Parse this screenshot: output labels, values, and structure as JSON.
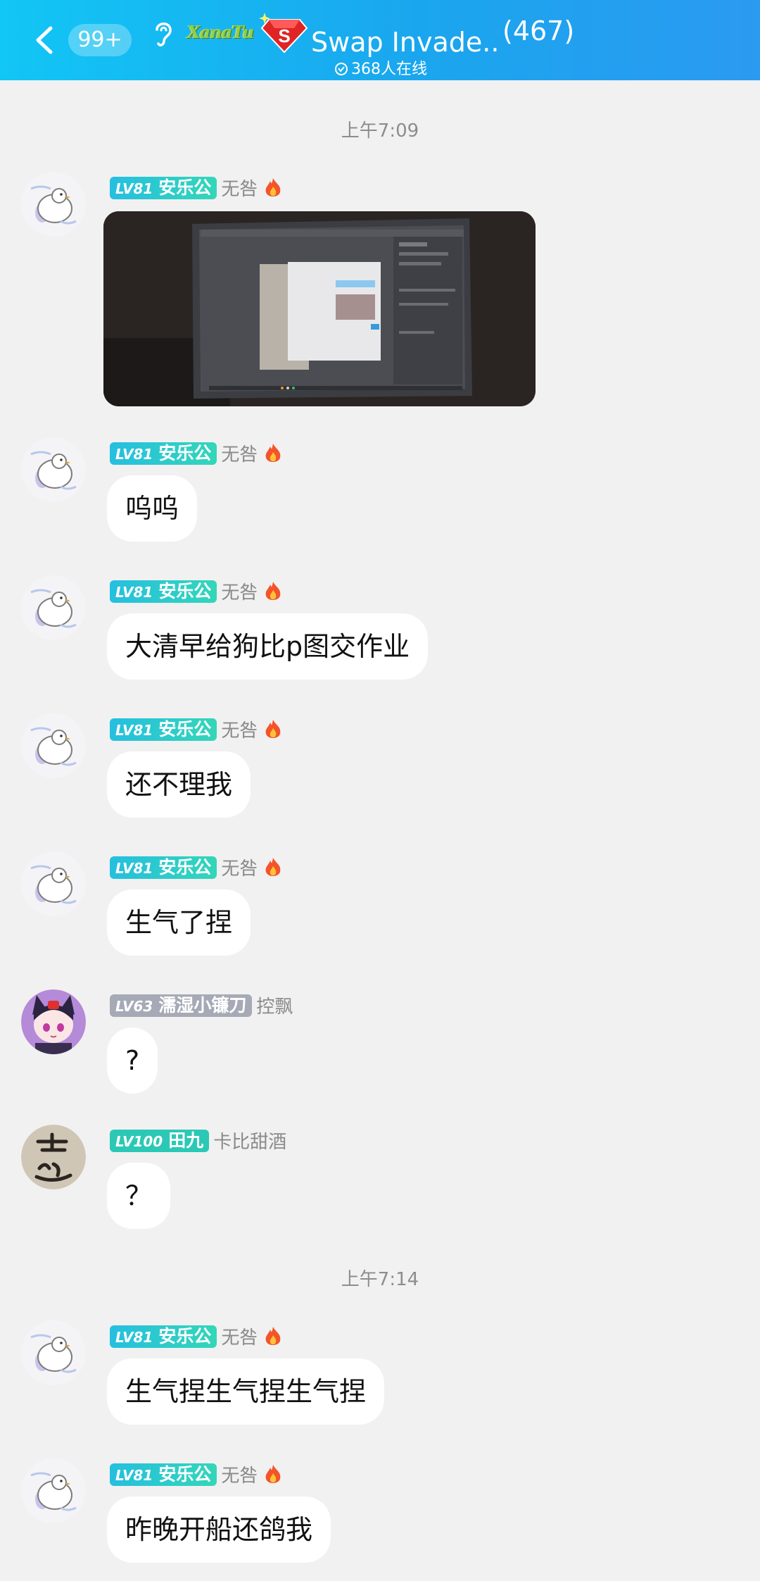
{
  "header": {
    "unread_badge": "99+",
    "group_title": "Swap Invade...",
    "member_count": "(467)",
    "online_text": "368人在线",
    "logo_text": "XanaTu"
  },
  "timestamps": [
    "上午7:09",
    "上午7:14"
  ],
  "messages": [
    {
      "level": "LV81",
      "nick": "安乐公",
      "tag": "无咎",
      "content": ""
    },
    {
      "level": "LV81",
      "nick": "安乐公",
      "tag": "无咎",
      "content": "呜呜"
    },
    {
      "level": "LV81",
      "nick": "安乐公",
      "tag": "无咎",
      "content": "大清早给狗比p图交作业"
    },
    {
      "level": "LV81",
      "nick": "安乐公",
      "tag": "无咎",
      "content": "还不理我"
    },
    {
      "level": "LV81",
      "nick": "安乐公",
      "tag": "无咎",
      "content": "生气了捏"
    },
    {
      "level": "LV63",
      "nick": "濡湿小镰刀",
      "tag": "控飘",
      "content": "?"
    },
    {
      "level": "LV100",
      "nick": "田九",
      "tag": "卡比甜酒",
      "content": "？"
    },
    {
      "level": "LV81",
      "nick": "安乐公",
      "tag": "无咎",
      "content": "生气捏生气捏生气捏"
    },
    {
      "level": "LV81",
      "nick": "安乐公",
      "tag": "无咎",
      "content": "昨晚开船还鸽我"
    }
  ],
  "colors": {
    "header_start": "#12c6f5",
    "header_end": "#2b9af0",
    "level_teal": "#25bfe0",
    "level_gray": "#a6aab6",
    "background": "#f1f1f1"
  },
  "icons": [
    "back-arrow-icon",
    "ear-icon",
    "ruby-gem-icon",
    "online-check-icon",
    "flame-icon"
  ]
}
